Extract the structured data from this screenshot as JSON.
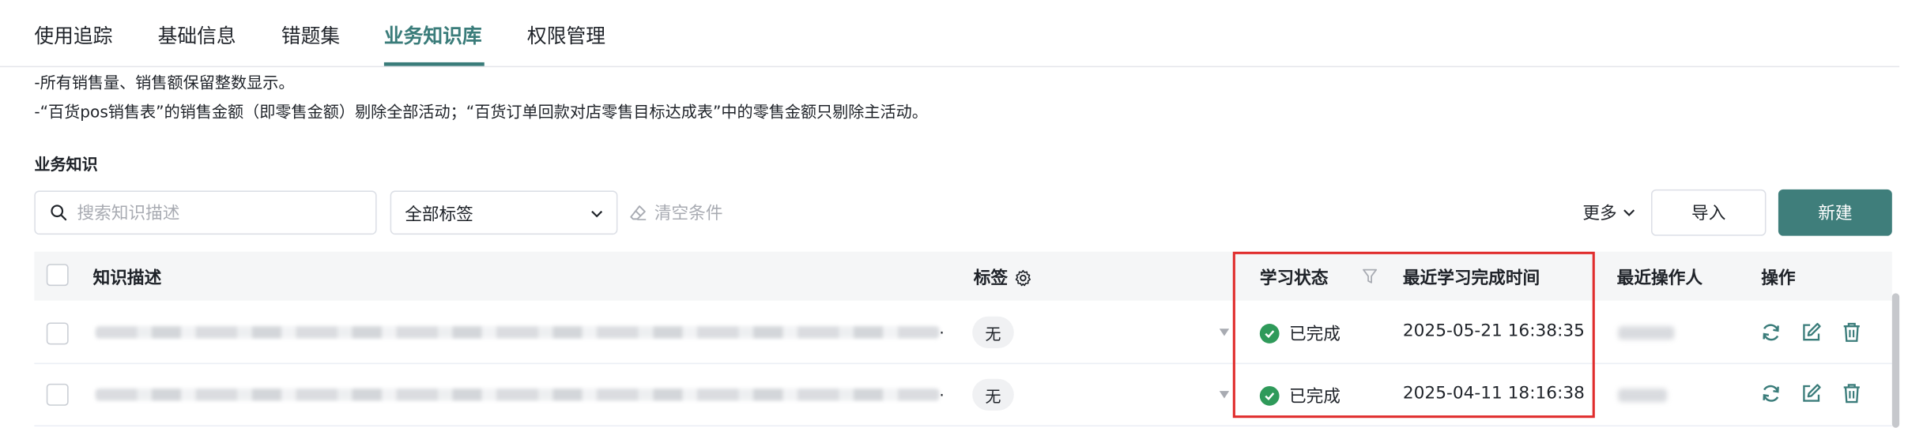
{
  "tabs": [
    {
      "label": "使用追踪"
    },
    {
      "label": "基础信息"
    },
    {
      "label": "错题集"
    },
    {
      "label": "业务知识库",
      "active": true
    },
    {
      "label": "权限管理"
    }
  ],
  "notes": [
    "-所有销售量、销售额保留整数显示。",
    "-“百货pos销售表”的销售金额（即零售金额）剔除全部活动；“百货订单回款对店零售目标达成表”中的零售金额只剔除主活动。"
  ],
  "section_title": "业务知识",
  "toolbar": {
    "search_placeholder": "搜索知识描述",
    "tag_select_value": "全部标签",
    "clear_label": "清空条件",
    "more_label": "更多",
    "import_label": "导入",
    "new_label": "新建"
  },
  "table": {
    "columns": {
      "desc": "知识描述",
      "tag": "标签",
      "status": "学习状态",
      "finish_time": "最近学习完成时间",
      "operator": "最近操作人",
      "actions": "操作"
    },
    "rows": [
      {
        "tag": "无",
        "status": "已完成",
        "finish_time": "2025-05-21 16:38:35"
      },
      {
        "tag": "无",
        "status": "已完成",
        "finish_time": "2025-04-11 18:16:38"
      }
    ]
  },
  "colors": {
    "accent": "#3a7c7a",
    "primary_button": "#3f7e7b",
    "success": "#2f9a5a",
    "highlight": "#e02d2d"
  }
}
